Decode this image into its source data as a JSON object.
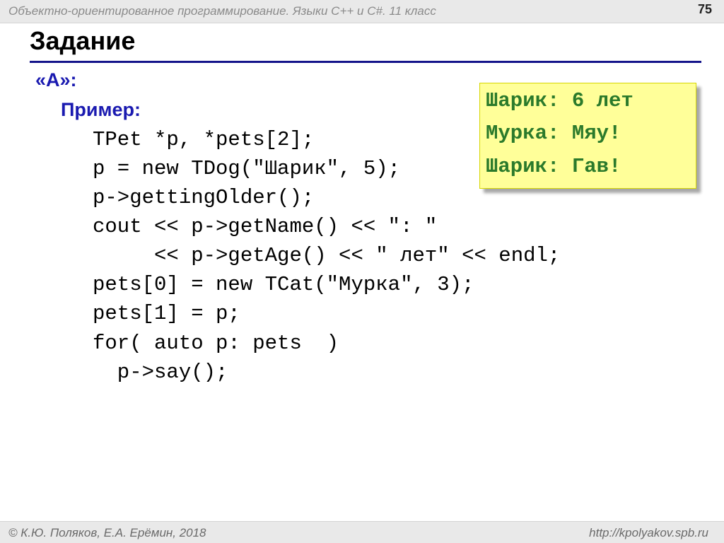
{
  "header": {
    "course": "Объектно-ориентированное программирование. Языки С++ и С#. 11 класс",
    "slide_number": "75"
  },
  "slide": {
    "title": "Задание",
    "variant": "«A»:",
    "example_label": "Пример",
    "example_colon": ":"
  },
  "code": {
    "lines": [
      "TPet *p, *pets[2];",
      "p = new TDog(\"Шарик\", 5);",
      "p->gettingOlder();",
      "cout << p->getName() << \": \"",
      "     << p->getAge() << \" лет\" << endl;",
      "pets[0] = new TCat(\"Мурка\", 3);",
      "pets[1] = p;",
      "for( auto p: pets  )",
      "  p->say();"
    ]
  },
  "output": {
    "lines": [
      "Шарик: 6 лет",
      "Мурка: Мяу!",
      "Шарик: Гав!"
    ]
  },
  "footer": {
    "authors": "© К.Ю. Поляков, Е.А. Ерёмин, 2018",
    "url": "http://kpolyakov.spb.ru"
  }
}
